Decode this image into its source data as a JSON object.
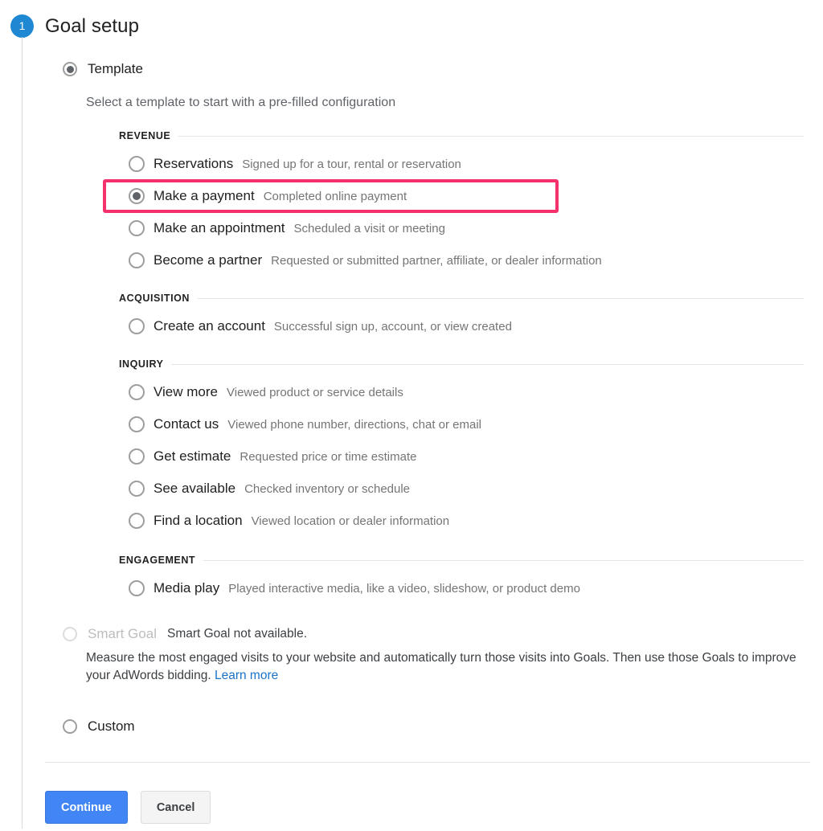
{
  "step": {
    "number": "1",
    "title": "Goal setup",
    "badge_color": "#1e88d2"
  },
  "template_option": {
    "label": "Template",
    "selected": true,
    "help_text": "Select a template to start with a pre-filled configuration"
  },
  "groups": [
    {
      "title": "REVENUE",
      "options": [
        {
          "name": "Reservations",
          "desc": "Signed up for a tour, rental or reservation",
          "selected": false
        },
        {
          "name": "Make a payment",
          "desc": "Completed online payment",
          "selected": true
        },
        {
          "name": "Make an appointment",
          "desc": "Scheduled a visit or meeting",
          "selected": false
        },
        {
          "name": "Become a partner",
          "desc": "Requested or submitted partner, affiliate, or dealer information",
          "selected": false
        }
      ]
    },
    {
      "title": "ACQUISITION",
      "options": [
        {
          "name": "Create an account",
          "desc": "Successful sign up, account, or view created",
          "selected": false
        }
      ]
    },
    {
      "title": "INQUIRY",
      "options": [
        {
          "name": "View more",
          "desc": "Viewed product or service details",
          "selected": false
        },
        {
          "name": "Contact us",
          "desc": "Viewed phone number, directions, chat or email",
          "selected": false
        },
        {
          "name": "Get estimate",
          "desc": "Requested price or time estimate",
          "selected": false
        },
        {
          "name": "See available",
          "desc": "Checked inventory or schedule",
          "selected": false
        },
        {
          "name": "Find a location",
          "desc": "Viewed location or dealer information",
          "selected": false
        }
      ]
    },
    {
      "title": "ENGAGEMENT",
      "options": [
        {
          "name": "Media play",
          "desc": "Played interactive media, like a video, slideshow, or product demo",
          "selected": false
        }
      ]
    }
  ],
  "highlight": {
    "target": "Make a payment",
    "color": "#f5316c"
  },
  "smart_goal": {
    "label": "Smart Goal",
    "status": "Smart Goal not available.",
    "description": "Measure the most engaged visits to your website and automatically turn those visits into Goals. Then use those Goals to improve your AdWords bidding. ",
    "link_text": "Learn more",
    "link_color": "#1a73c8",
    "disabled": true
  },
  "custom_option": {
    "label": "Custom",
    "selected": false
  },
  "footer": {
    "continue_label": "Continue",
    "cancel_label": "Cancel",
    "continue_color": "#4285f4"
  }
}
